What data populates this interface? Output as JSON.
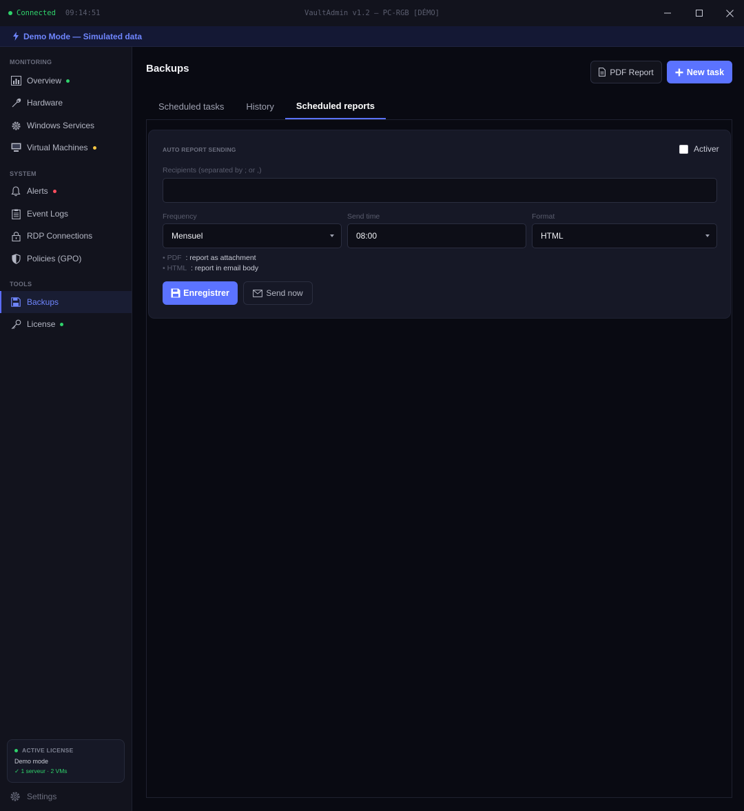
{
  "titlebar": {
    "status": "Connected",
    "time": "09:14:51",
    "title": "VaultAdmin v1.2 — PC-RGB [DÉMO]"
  },
  "demo_banner": {
    "text": "Demo Mode — Simulated data"
  },
  "sidebar": {
    "sections": {
      "monitoring": "MONITORING",
      "system": "SYSTEM",
      "tools": "TOOLS"
    },
    "items": [
      {
        "label": "Overview",
        "icon": "chart-icon",
        "dot_color": "#2fd26b"
      },
      {
        "label": "Hardware",
        "icon": "wrench-icon"
      },
      {
        "label": "Windows Services",
        "icon": "gear-icon"
      },
      {
        "label": "Virtual Machines",
        "icon": "monitor-icon",
        "dot_color": "#f5c542"
      },
      {
        "label": "Alerts",
        "icon": "bell-icon",
        "dot_color": "#ff4d5e"
      },
      {
        "label": "Event Logs",
        "icon": "clipboard-icon"
      },
      {
        "label": "RDP Connections",
        "icon": "lock-icon"
      },
      {
        "label": "Policies (GPO)",
        "icon": "shield-icon"
      },
      {
        "label": "Backups",
        "icon": "floppy-icon",
        "active": true
      },
      {
        "label": "License",
        "icon": "key-icon",
        "dot_color": "#2fd26b"
      }
    ],
    "license": {
      "title": "ACTIVE LICENSE",
      "mode": "Demo mode",
      "info": "✓ 1 serveur · 2 VMs"
    },
    "settings": "Settings"
  },
  "main": {
    "title": "Backups",
    "pdf_report": "PDF Report",
    "new_task": "New task",
    "tabs": [
      {
        "label": "Scheduled tasks"
      },
      {
        "label": "History"
      },
      {
        "label": "Scheduled reports",
        "active": true
      }
    ],
    "card": {
      "title": "AUTO REPORT SENDING",
      "enable_label": "Activer",
      "enabled": false,
      "recipients_label": "Recipients (separated by ; or ,)",
      "recipients_value": "",
      "frequency_label": "Frequency",
      "frequency_value": "Mensuel",
      "send_time_label": "Send time",
      "send_time_value": "08:00",
      "format_label": "Format",
      "format_value": "HTML",
      "hint_pdf_key": "PDF",
      "hint_pdf_text": ": report as attachment",
      "hint_html_key": "HTML",
      "hint_html_text": ": report in email body",
      "save_label": "Enregistrer",
      "send_now_label": "Send now"
    }
  },
  "colors": {
    "accent": "#5b73ff",
    "success": "#2fd26b",
    "warning": "#f5c542",
    "danger": "#ff4d5e"
  }
}
